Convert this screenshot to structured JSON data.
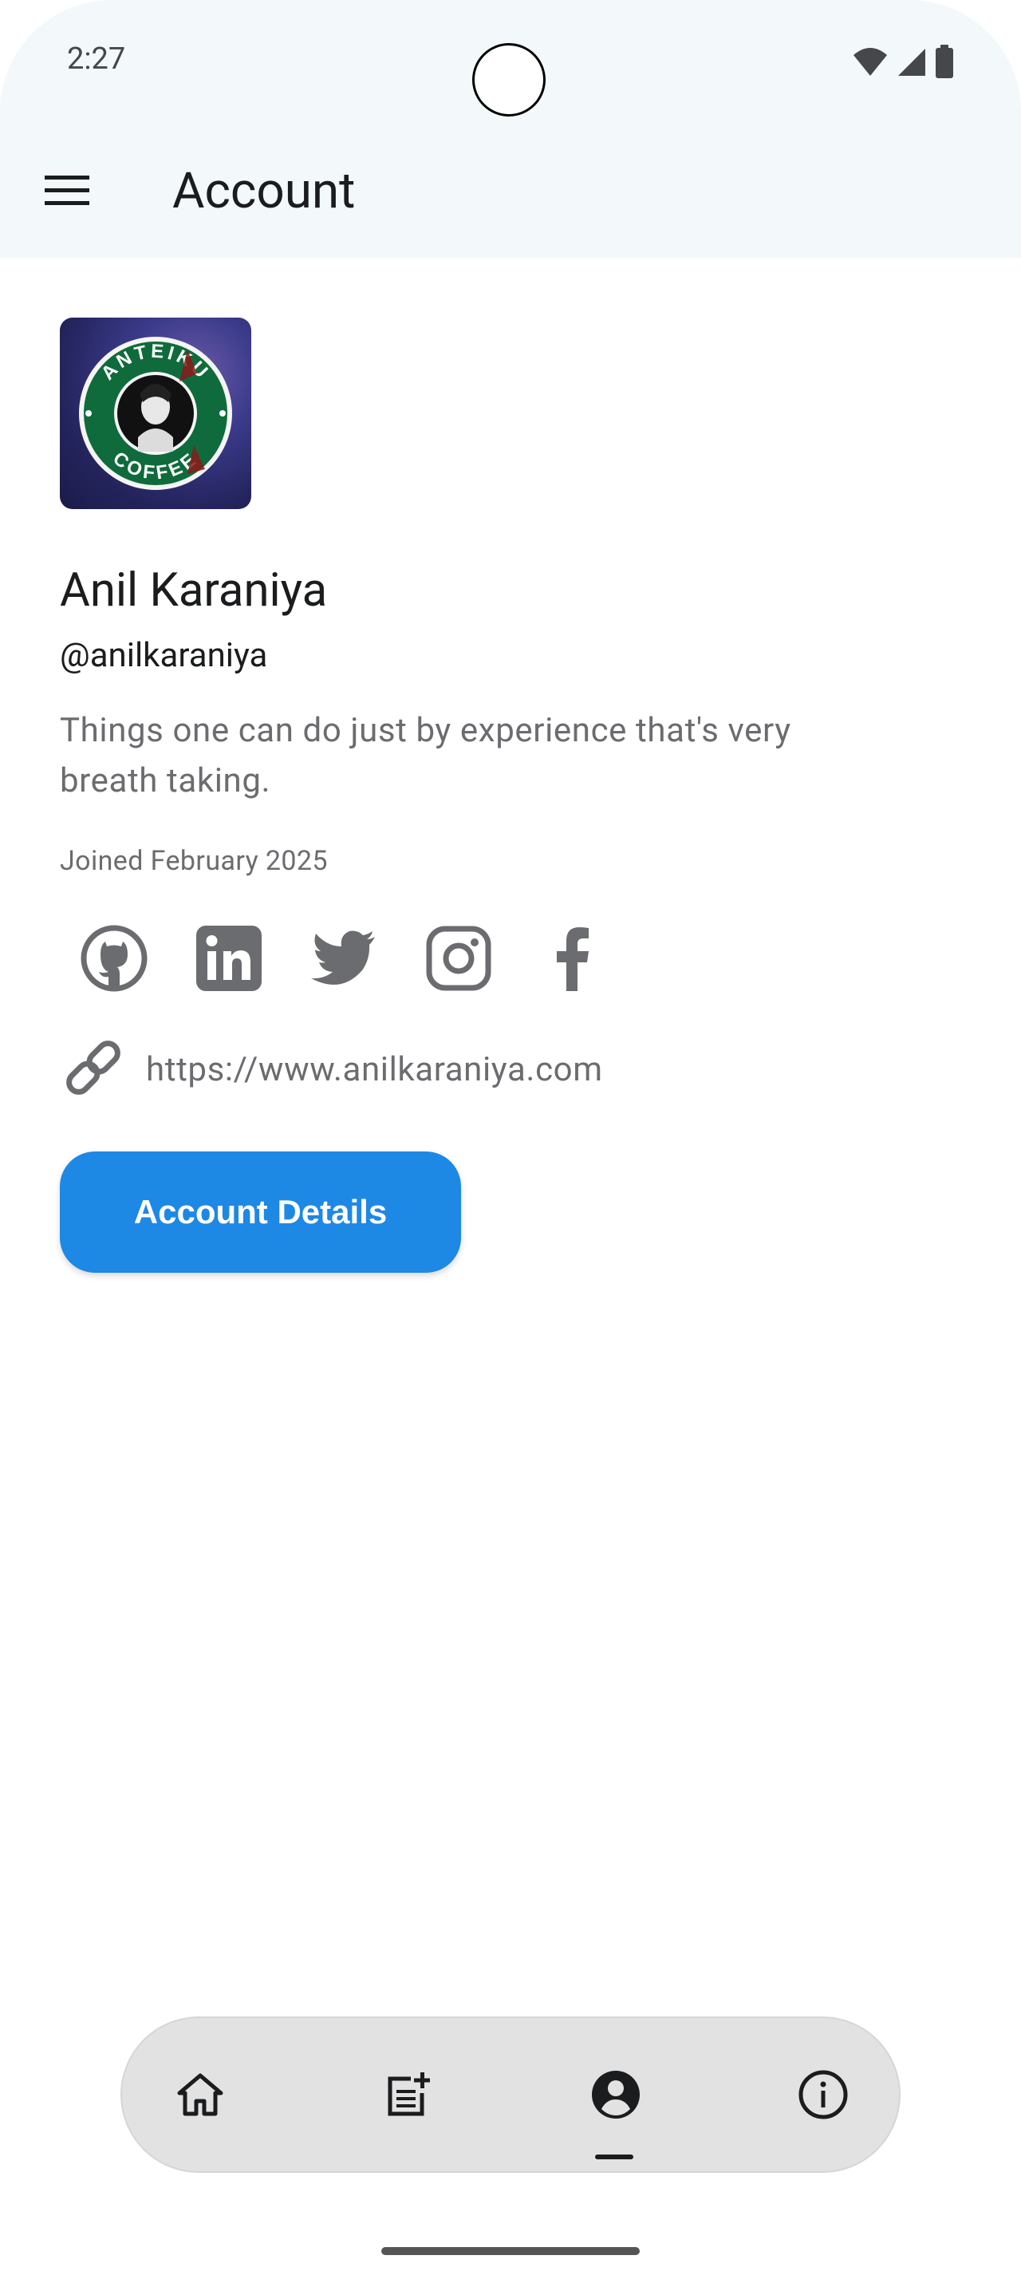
{
  "status_bar": {
    "time": "2:27",
    "icons": [
      "wifi-icon",
      "cellular-signal-icon",
      "battery-icon"
    ]
  },
  "app_bar": {
    "menu_icon": "hamburger-menu-icon",
    "title": "Account"
  },
  "profile": {
    "avatar": "profile-avatar-image",
    "avatar_text": [
      "ANTEIKU",
      "COFFEE"
    ],
    "name": "Anil Karaniya",
    "handle": "@anilkaraniya",
    "bio": "Things one can do just by experience that's very breath taking.",
    "joined": "Joined February 2025"
  },
  "socials": [
    {
      "name": "github",
      "icon": "github-icon"
    },
    {
      "name": "linkedin",
      "icon": "linkedin-icon"
    },
    {
      "name": "twitter",
      "icon": "twitter-icon"
    },
    {
      "name": "instagram",
      "icon": "instagram-icon"
    },
    {
      "name": "facebook",
      "icon": "facebook-icon"
    }
  ],
  "website": {
    "icon": "link-icon",
    "url": "https://www.anilkaraniya.com"
  },
  "actions": {
    "account_details_label": "Account Details"
  },
  "bottom_nav": {
    "items": [
      {
        "name": "home",
        "icon": "home-icon",
        "selected": false
      },
      {
        "name": "new-post",
        "icon": "post-add-icon",
        "selected": false
      },
      {
        "name": "account",
        "icon": "account-circle-icon",
        "selected": true
      },
      {
        "name": "info",
        "icon": "info-icon",
        "selected": false
      }
    ]
  },
  "colors": {
    "accent": "#1e88e5",
    "top_area": "#f3f8fb",
    "icon_gray": "#6b6c6f",
    "nav_bg": "#e2e2e2"
  }
}
